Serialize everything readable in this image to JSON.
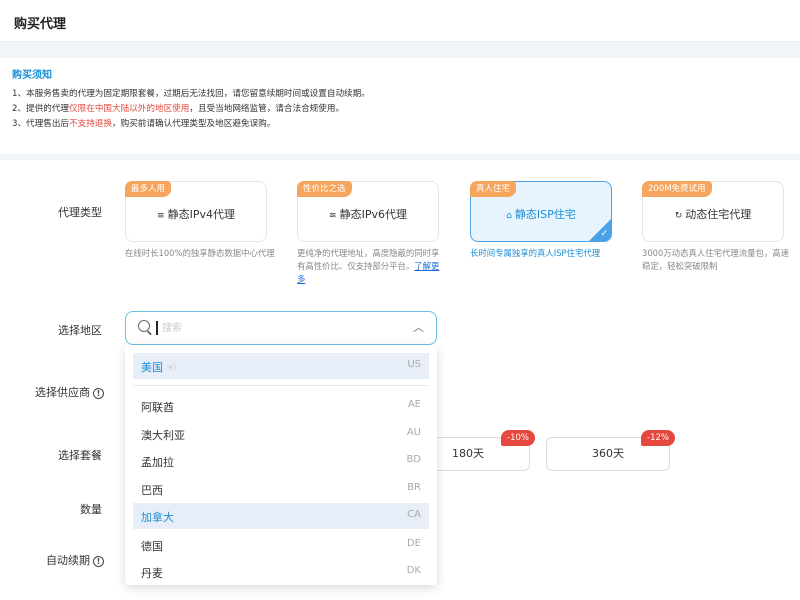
{
  "header": {
    "title": "购买代理"
  },
  "notice": {
    "title": "购买须知",
    "line1": "1、本服务售卖的代理为固定期限套餐，过期后无法找回，请您留意续期时间或设置自动续期。",
    "line2_a": "2、提供的代理",
    "line2_red": "仅限在中国大陆以外的地区使用",
    "line2_b": "，且受当地网络监管，请合法合规使用。",
    "line3_a": "3、代理售出后",
    "line3_red": "不支持退换",
    "line3_b": "，购买前请确认代理类型及地区避免误购。"
  },
  "form": {
    "proxy_type_label": "代理类型",
    "region_label": "选择地区",
    "provider_label": "选择供应商",
    "plan_label": "选择套餐",
    "quantity_label": "数量",
    "auto_renew_label": "自动续期",
    "info_glyph": "!"
  },
  "proxy_types": [
    {
      "badge": "最多人用",
      "name": "静态IPv4代理",
      "icon": "list-icon",
      "glyph": "≡",
      "desc": "在线时长100%的独享静态数据中心代理"
    },
    {
      "badge": "性价比之选",
      "name": "静态IPv6代理",
      "icon": "layers-icon",
      "glyph": "≋",
      "desc": "更纯净的代理地址，高度隐蔽的同时享有高性价比。仅支持部分平台。",
      "learn_more": "了解更多"
    },
    {
      "badge": "真人住宅",
      "name": "静态ISP住宅",
      "icon": "home-icon",
      "glyph": "⌂",
      "desc": "长时间专属独享的真人ISP住宅代理",
      "selected": true
    },
    {
      "badge": "200M免费试用",
      "name": "动态住宅代理",
      "icon": "refresh-icon",
      "glyph": "↻",
      "desc": "3000万动态真人住宅代理流量包，高速稳定，轻松突破限制"
    }
  ],
  "search": {
    "placeholder": "搜索",
    "value": ""
  },
  "dropdown": {
    "pinned": {
      "name": "美国",
      "code": "US",
      "icon": "hand-icon"
    },
    "options": [
      {
        "name": "阿联酋",
        "code": "AE"
      },
      {
        "name": "澳大利亚",
        "code": "AU"
      },
      {
        "name": "孟加拉",
        "code": "BD"
      },
      {
        "name": "巴西",
        "code": "BR"
      },
      {
        "name": "加拿大",
        "code": "CA",
        "highlighted": true
      },
      {
        "name": "德国",
        "code": "DE"
      },
      {
        "name": "丹麦",
        "code": "DK"
      }
    ]
  },
  "durations": [
    {
      "label": "180天",
      "discount": "-10%"
    },
    {
      "label": "360天",
      "discount": "-12%"
    }
  ],
  "colors": {
    "accent": "#1a8fd6",
    "badge": "#f5a55c",
    "discount": "#e5483e",
    "selected_bg": "#e8f4fd"
  }
}
